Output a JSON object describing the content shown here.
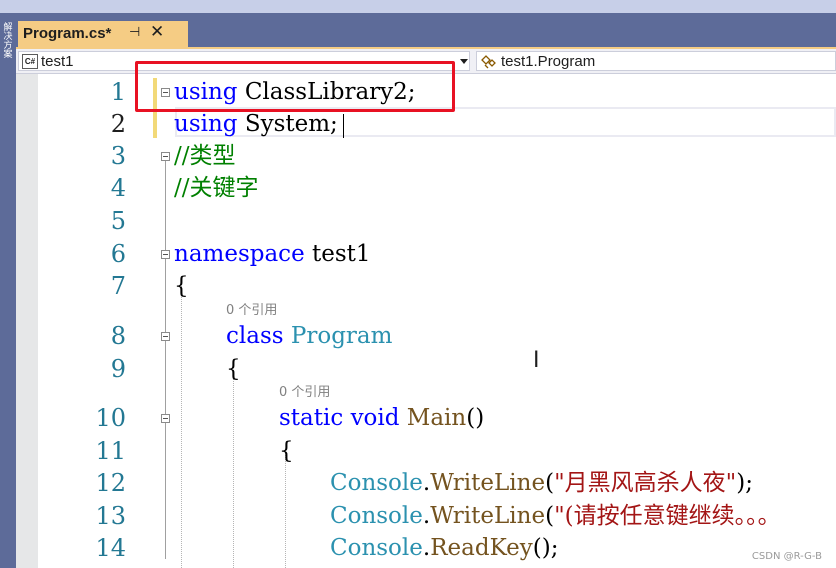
{
  "window": {
    "side_rail_text": "解决方案"
  },
  "tab": {
    "title": "Program.cs*",
    "pin_icon": "pin-icon",
    "close_icon": "close-icon"
  },
  "navbar": {
    "project": "test1",
    "scope": "test1.Program"
  },
  "code_lines": [
    {
      "num": "1",
      "text": "using ClassLibrary2;"
    },
    {
      "num": "2",
      "text": "using System;"
    },
    {
      "num": "3",
      "text": "//类型"
    },
    {
      "num": "4",
      "text": "//关键字"
    },
    {
      "num": "5",
      "text": ""
    },
    {
      "num": "6",
      "text": "namespace test1"
    },
    {
      "num": "7",
      "text": "{"
    },
    {
      "num": "8",
      "text": "class Program"
    },
    {
      "num": "9",
      "text": "{"
    },
    {
      "num": "10",
      "text": "static void Main()"
    },
    {
      "num": "11",
      "text": "{"
    },
    {
      "num": "12",
      "text": "Console.WriteLine(\"月黑风高杀人夜\");"
    },
    {
      "num": "13",
      "text": "Console.WriteLine(\"(请按任意键继续。。。"
    },
    {
      "num": "14",
      "text": "Console.ReadKey();"
    }
  ],
  "tokens": {
    "using": "using",
    "classlib": " ClassLibrary2;",
    "system": " System;",
    "comment1": "//类型",
    "comment2": "//关键字",
    "namespace": "namespace",
    "ns_name": " test1",
    "brace_open": "{",
    "class_kw": "class",
    "class_name": "Program",
    "static": "static",
    "void": "void",
    "main": "Main",
    "parens": "()",
    "console": "Console",
    "dot": ".",
    "writeline": "WriteLine",
    "readkey": "ReadKey",
    "str1": "\"月黑风高杀人夜\"",
    "str2": "\"(请按任意键继续。。。",
    "open_paren": "(",
    "close_paren_semi": ");",
    "call_end": "();"
  },
  "ref_hint": "0 个引用",
  "watermark": "CSDN @R-G-B",
  "colors": {
    "keyword": "#0000ff",
    "type": "#2b91af",
    "method": "#74531f",
    "string": "#a31515",
    "comment": "#008000",
    "highlight_box": "#e81123",
    "tab_active": "#f5cc84"
  }
}
